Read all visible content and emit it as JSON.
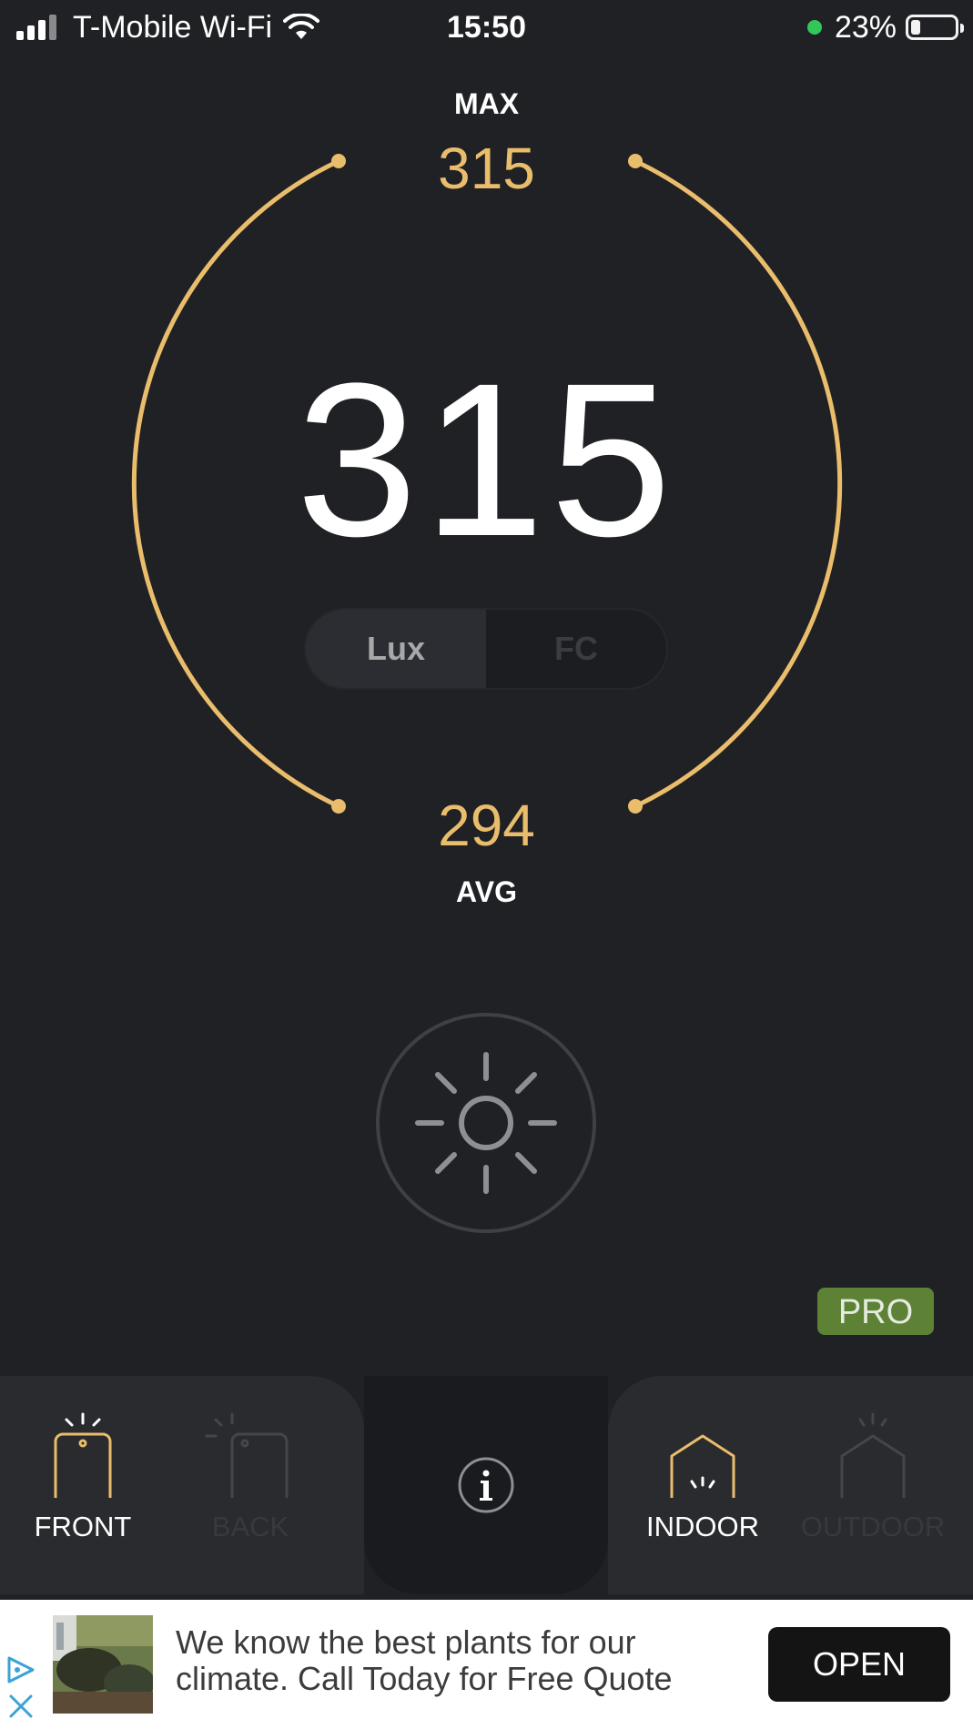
{
  "status_bar": {
    "carrier": "T-Mobile Wi-Fi",
    "time": "15:50",
    "battery_percent": "23%",
    "battery_level": 0.23
  },
  "meter": {
    "max_label": "MAX",
    "max_value": "315",
    "current_value": "315",
    "avg_value": "294",
    "avg_label": "AVG",
    "accent_color": "#e9bd6c",
    "units": [
      {
        "label": "Lux",
        "selected": true
      },
      {
        "label": "FC",
        "selected": false
      }
    ]
  },
  "light_button": {
    "icon": "sun-icon"
  },
  "pro_badge": {
    "label": "PRO",
    "color": "#5d8235"
  },
  "bottom_bar": {
    "sensor": {
      "front": {
        "label": "FRONT",
        "selected": true,
        "icon": "phone-front-icon"
      },
      "back": {
        "label": "BACK",
        "selected": false,
        "icon": "phone-back-icon"
      }
    },
    "info": {
      "icon": "info-icon"
    },
    "environment": {
      "indoor": {
        "label": "INDOOR",
        "selected": true,
        "icon": "house-indoor-icon"
      },
      "outdoor": {
        "label": "OUTDOOR",
        "selected": false,
        "icon": "house-outdoor-icon"
      }
    }
  },
  "ad": {
    "text": "We know the best plants for our climate. Call Today for Free Quote",
    "button_label": "OPEN",
    "adchoices_icon": "adchoices-icon",
    "close_icon": "close-icon"
  }
}
